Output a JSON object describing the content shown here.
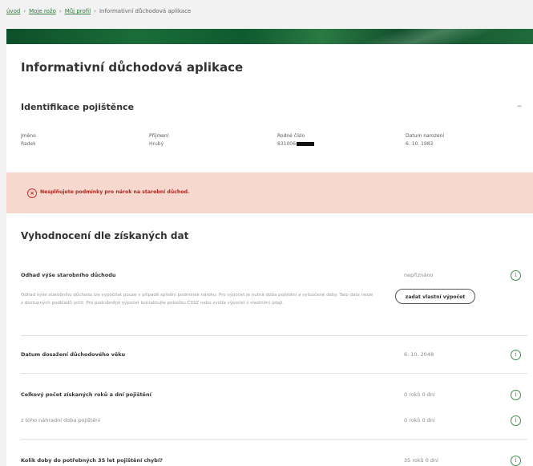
{
  "breadcrumb": {
    "items": [
      "úvod",
      "Moje rožo",
      "Můj profil"
    ],
    "current": "Informativní důchodová aplikace"
  },
  "page": {
    "title": "Informativní důchodová aplikace"
  },
  "insured": {
    "section_title": "Identifikace pojištěnce",
    "fields": [
      {
        "label": "Jméno",
        "value": "Radek"
      },
      {
        "label": "Příjmení",
        "value": "Hrubý"
      },
      {
        "label": "Rodné číslo",
        "value": "831006"
      },
      {
        "label": "Datum narození",
        "value": "6. 10. 1983"
      }
    ]
  },
  "alert": {
    "text": "Nesplňujete podmínky pro nárok na starobní důchod."
  },
  "evaluation": {
    "title": "Vyhodnocení dle získaných dat",
    "rows": [
      {
        "label": "Odhad výše starobního důchodu",
        "value": "nepřiznáno",
        "description": "Odhad výše starobního důchodu lze vypočítat pouze v případě splnění podmínek nároku. Pro výpočet je nutná doba pojištění a vyloučené doby. Tato data nelze z dostupných podkladů určit. Pro podrobnější výpočet kontaktujte pobočku ČSSZ nebo zvolte výpočet s vlastními údaji.",
        "button": "zadat vlastní výpočet"
      },
      {
        "label": "Datum dosažení důchodového věku",
        "value": "6. 10. 2048"
      },
      {
        "label": "Celkový počet získaných roků a dní pojištění",
        "value": "0 roků 0 dní"
      },
      {
        "label": "z toho náhradní doba pojištění",
        "value": "0 roků 0 dní"
      },
      {
        "label": "Kolik doby do potřebných 35 let pojištění chybí?",
        "value": "35 roků 0 dní"
      }
    ]
  }
}
